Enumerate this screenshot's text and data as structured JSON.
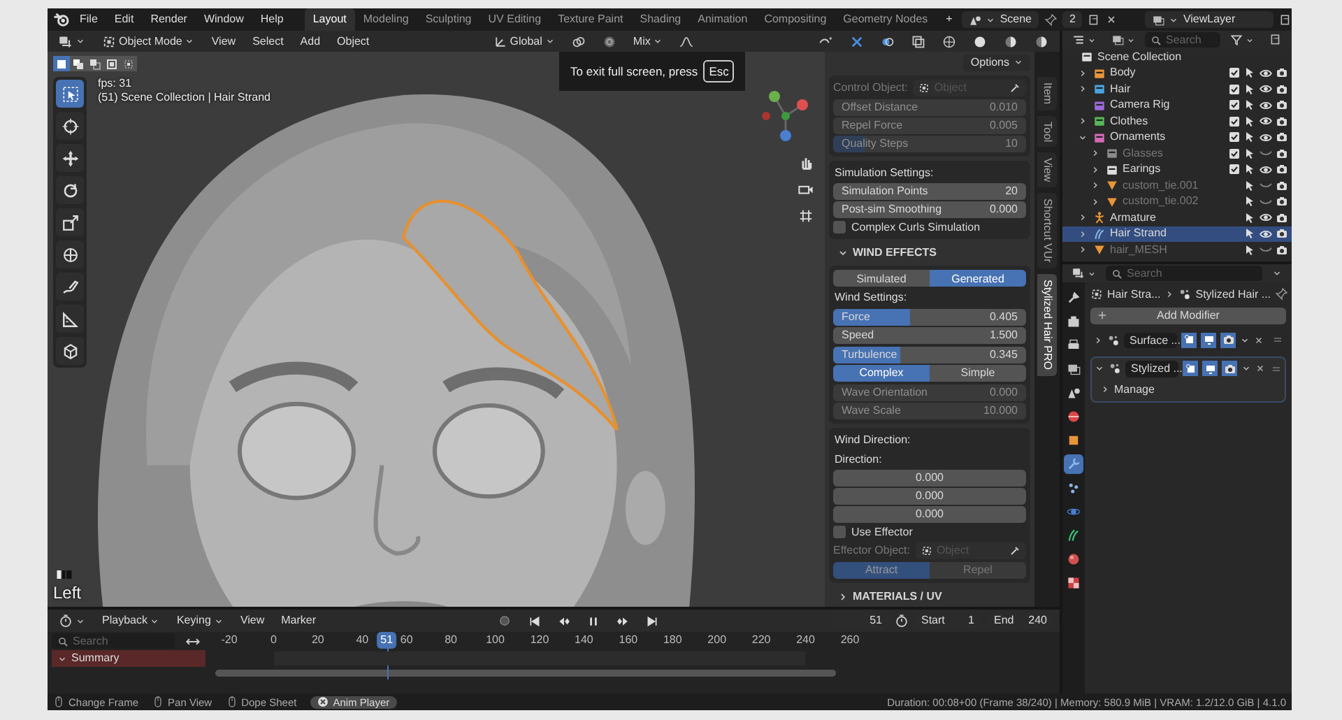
{
  "menubar": {
    "menus": [
      "File",
      "Edit",
      "Render",
      "Window",
      "Help"
    ],
    "workspaces": [
      {
        "label": "Layout",
        "selected": true
      },
      {
        "label": "Modeling",
        "selected": false
      },
      {
        "label": "Sculpting",
        "selected": false
      },
      {
        "label": "UV Editing",
        "selected": false
      },
      {
        "label": "Texture Paint",
        "selected": false
      },
      {
        "label": "Shading",
        "selected": false
      },
      {
        "label": "Animation",
        "selected": false
      },
      {
        "label": "Compositing",
        "selected": false
      },
      {
        "label": "Geometry Nodes",
        "selected": false
      }
    ],
    "add_workspace": "+",
    "scene": "Scene",
    "scene_users": "2",
    "view_layer": "ViewLayer"
  },
  "viewport": {
    "header": {
      "mode": "Object Mode",
      "menus": [
        "View",
        "Select",
        "Add",
        "Object"
      ],
      "orientation": "Global",
      "snap_mode": "Mix"
    },
    "selection_modes": [
      {
        "kind": "set",
        "selected": true
      },
      {
        "kind": "extend",
        "selected": false
      },
      {
        "kind": "subtract",
        "selected": false
      },
      {
        "kind": "invert",
        "selected": false
      },
      {
        "kind": "intersect",
        "selected": false
      }
    ],
    "tools": [
      {
        "kind": "select",
        "selected": true
      },
      {
        "kind": "cursor",
        "selected": false
      },
      {
        "kind": "move",
        "selected": false
      },
      {
        "kind": "rotate",
        "selected": false
      },
      {
        "kind": "scale",
        "selected": false
      },
      {
        "kind": "transform",
        "selected": false
      },
      {
        "kind": "annotate",
        "selected": false
      },
      {
        "kind": "measure",
        "selected": false
      },
      {
        "kind": "add",
        "selected": false
      }
    ],
    "overlay": {
      "fps": "fps: 31",
      "context": "(51) Scene Collection | Hair Strand",
      "view_name": "Left"
    },
    "fullscreen_notice": {
      "text": "To exit full screen, press",
      "key": "Esc"
    },
    "sidebar": {
      "options": "Options",
      "tabs": [
        {
          "label": "Item",
          "selected": false
        },
        {
          "label": "Tool",
          "selected": false
        },
        {
          "label": "View",
          "selected": false
        },
        {
          "label": "Shortcut VUr",
          "selected": false
        },
        {
          "label": "Stylized Hair PRO",
          "selected": true
        }
      ],
      "panels": [
        {
          "kind": "box",
          "items": [
            {
              "kind": "object_field",
              "label": "Control Object:",
              "placeholder": "Object",
              "disabled": true
            },
            {
              "kind": "group",
              "rows": [
                {
                  "kind": "slider",
                  "label": "Offset Distance",
                  "value": "0.010",
                  "disabled": true
                },
                {
                  "kind": "slider",
                  "label": "Repel Force",
                  "value": "0.005",
                  "disabled": true
                },
                {
                  "kind": "slider",
                  "label": "Quality Steps",
                  "value": "10",
                  "disabled": true,
                  "level": 0.17
                }
              ]
            }
          ]
        },
        {
          "kind": "box",
          "items": [
            {
              "kind": "heading",
              "label": "Simulation Settings:"
            },
            {
              "kind": "group",
              "rows": [
                {
                  "kind": "slider",
                  "label": "Simulation Points",
                  "value": "20",
                  "disabled": false
                },
                {
                  "kind": "slider",
                  "label": "Post-sim Smoothing",
                  "value": "0.000",
                  "disabled": false
                }
              ]
            },
            {
              "kind": "checkbox",
              "label": "Complex Curls Simulation",
              "checked": false
            }
          ]
        },
        {
          "kind": "section",
          "label": "WIND EFFECTS",
          "expanded": true
        },
        {
          "kind": "box",
          "items": [
            {
              "kind": "toggle",
              "disabled": false,
              "options": [
                {
                  "label": "Simulated",
                  "selected": false
                },
                {
                  "label": "Generated",
                  "selected": true
                }
              ]
            },
            {
              "kind": "heading",
              "label": "Wind Settings:"
            },
            {
              "kind": "group",
              "rows": [
                {
                  "kind": "slider",
                  "label": "Force",
                  "value": "0.405",
                  "disabled": false,
                  "level": 0.4
                },
                {
                  "kind": "slider",
                  "label": "Speed",
                  "value": "1.500",
                  "disabled": false
                }
              ]
            },
            {
              "kind": "group",
              "rows": [
                {
                  "kind": "slider",
                  "label": "Turbulence",
                  "value": "0.345",
                  "disabled": false,
                  "level": 0.345
                },
                {
                  "kind": "toggle",
                  "disabled": false,
                  "options": [
                    {
                      "label": "Complex",
                      "selected": true
                    },
                    {
                      "label": "Simple",
                      "selected": false
                    }
                  ]
                }
              ]
            },
            {
              "kind": "group",
              "rows": [
                {
                  "kind": "slider",
                  "label": "Wave Orientation",
                  "value": "0.000",
                  "disabled": true
                },
                {
                  "kind": "slider",
                  "label": "Wave Scale",
                  "value": "10.000",
                  "disabled": true
                }
              ]
            }
          ]
        },
        {
          "kind": "box",
          "items": [
            {
              "kind": "heading",
              "label": "Wind Direction:"
            },
            {
              "kind": "heading",
              "label": "Direction:"
            },
            {
              "kind": "group",
              "rows": [
                {
                  "kind": "number",
                  "value": "0.000"
                },
                {
                  "kind": "number",
                  "value": "0.000"
                },
                {
                  "kind": "number",
                  "value": "0.000"
                }
              ]
            },
            {
              "kind": "checkbox",
              "label": "Use Effector",
              "checked": false
            },
            {
              "kind": "object_field",
              "label": "Effector Object:",
              "placeholder": "Object",
              "disabled": true
            },
            {
              "kind": "toggle",
              "disabled": true,
              "options": [
                {
                  "label": "Attract",
                  "selected": true
                },
                {
                  "label": "Repel",
                  "selected": false
                }
              ]
            }
          ]
        },
        {
          "kind": "section",
          "label": "MATERIALS / UV",
          "expanded": false
        }
      ]
    }
  },
  "timeline": {
    "menus": [
      "Playback",
      "Keying",
      "View",
      "Marker"
    ],
    "current_frame": "51",
    "start_label": "Start",
    "start": "1",
    "end_label": "End",
    "end": "240",
    "search_placeholder": "Search",
    "ruler": [
      "-20",
      "0",
      "20",
      "40",
      "60",
      "80",
      "100",
      "120",
      "140",
      "160",
      "180",
      "200",
      "220",
      "240",
      "260"
    ],
    "playhead": "51",
    "channels": [
      "Summary"
    ]
  },
  "outliner": {
    "search_placeholder": "Search",
    "tree": [
      {
        "label": "Scene Collection",
        "kind": "scene",
        "selected": false,
        "children": [
          {
            "label": "Body",
            "kind": "collection",
            "color": "#e8953a",
            "expanded": false,
            "hidden": false,
            "selected": false
          },
          {
            "label": "Hair",
            "kind": "collection",
            "color": "#4aa3e0",
            "expanded": false,
            "hidden": false,
            "selected": false
          },
          {
            "label": "Camera Rig",
            "kind": "collection",
            "color": "#9c6ad8",
            "hidden": false,
            "selected": false
          },
          {
            "label": "Clothes",
            "kind": "collection",
            "color": "#58b858",
            "expanded": false,
            "hidden": false,
            "selected": false
          },
          {
            "label": "Ornaments",
            "kind": "collection",
            "color": "#d36ab8",
            "expanded": true,
            "hidden": false,
            "selected": false,
            "children": [
              {
                "label": "Glasses",
                "kind": "collection",
                "color": "#8a8a8a",
                "expanded": false,
                "hidden": true,
                "selected": false
              },
              {
                "label": "Earings",
                "kind": "collection",
                "color": "#dddddd",
                "expanded": false,
                "hidden": false,
                "selected": false
              },
              {
                "label": "custom_tie.001",
                "kind": "mesh",
                "expanded": false,
                "hidden": true,
                "selected": false
              },
              {
                "label": "custom_tie.002",
                "kind": "mesh",
                "expanded": false,
                "hidden": true,
                "selected": false
              }
            ]
          },
          {
            "label": "Armature",
            "kind": "armature",
            "expanded": false,
            "hidden": false,
            "selected": false
          },
          {
            "label": "Hair Strand",
            "kind": "curves",
            "expanded": false,
            "hidden": false,
            "selected": true
          },
          {
            "label": "hair_MESH",
            "kind": "mesh",
            "expanded": false,
            "hidden": true,
            "selected": false
          }
        ]
      }
    ]
  },
  "properties": {
    "search_placeholder": "Search",
    "tabs": [
      {
        "kind": "tool",
        "selected": false
      },
      {
        "kind": "render",
        "selected": false
      },
      {
        "kind": "output",
        "selected": false
      },
      {
        "kind": "view_layer",
        "selected": false
      },
      {
        "kind": "scene",
        "selected": false
      },
      {
        "kind": "world",
        "selected": false
      },
      {
        "kind": "object",
        "selected": false
      },
      {
        "kind": "modifiers",
        "selected": true
      },
      {
        "kind": "particles",
        "selected": false
      },
      {
        "kind": "physics",
        "selected": false
      },
      {
        "kind": "data",
        "selected": false
      },
      {
        "kind": "material",
        "selected": false
      },
      {
        "kind": "texture",
        "selected": false
      }
    ],
    "breadcrumb": [
      "Hair Stra...",
      "Stylized Hair ..."
    ],
    "add_modifier": "Add Modifier",
    "modifiers": [
      {
        "name": "Surface ...",
        "expanded": false
      },
      {
        "name": "Stylized ...",
        "expanded": true,
        "subpanels": [
          "Manage"
        ]
      }
    ]
  },
  "status_bar": {
    "hints": [
      {
        "kind": "hint",
        "label": "Change Frame"
      },
      {
        "kind": "hint",
        "label": "Pan View"
      },
      {
        "kind": "hint",
        "label": "Dope Sheet"
      },
      {
        "kind": "job",
        "label": "Anim Player"
      }
    ],
    "stats": "Duration: 00:08+00 (Frame 38/240) | Memory: 580.9 MiB | VRAM: 1.2/12.0 GiB | 4.1.0"
  }
}
